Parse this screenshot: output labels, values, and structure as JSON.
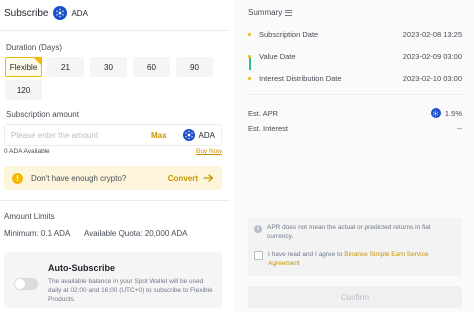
{
  "header": {
    "title": "Subscribe",
    "coin": "ADA"
  },
  "duration": {
    "label": "Duration (Days)",
    "options": [
      "Flexible",
      "21",
      "30",
      "60",
      "90",
      "120"
    ]
  },
  "subscription": {
    "label": "Subscription amount",
    "placeholder": "Please enter the amount",
    "max_label": "Max",
    "coin": "ADA",
    "available_amount": "0 ADA",
    "available_label": "Available",
    "buy_now": "Buy Now"
  },
  "convert_prompt": {
    "question": "Don't have enough crypto?",
    "action": "Convert"
  },
  "limits": {
    "title": "Amount Limits",
    "minimum": "Minimum: 0.1 ADA",
    "available_quota": "Available Quota: 20,000 ADA"
  },
  "auto_subscribe": {
    "title": "Auto-Subscribe",
    "description": "The available balance in your Spot Wallet will be used daily at 02:00 and 16:00 (UTC+0) to subscribe to Flexible Products."
  },
  "summary": {
    "title": "Summary",
    "timeline": [
      {
        "label": "Subscription Date",
        "value": "2023-02-08 13:25"
      },
      {
        "label": "Value Date",
        "value": "2023-02-09 03:00"
      },
      {
        "label": "Interest Distribution Date",
        "value": "2023-02-10 03:00"
      }
    ],
    "est_apr_label": "Est. APR",
    "est_apr_value": "1.5%",
    "est_interest_label": "Est. Interest",
    "est_interest_value": "--"
  },
  "notice": {
    "text": "APR does not mean the actual or predicted returns in fiat currency.",
    "agree_prefix": "I have read and I agree to ",
    "agree_link": "Binance Simple Earn Service Agreement"
  },
  "confirm_label": "Confirm",
  "colors": {
    "accent": "#f0b90b",
    "link": "#c99400",
    "ada": "#1a4fc9",
    "timeline_active": "#2ebd85"
  }
}
